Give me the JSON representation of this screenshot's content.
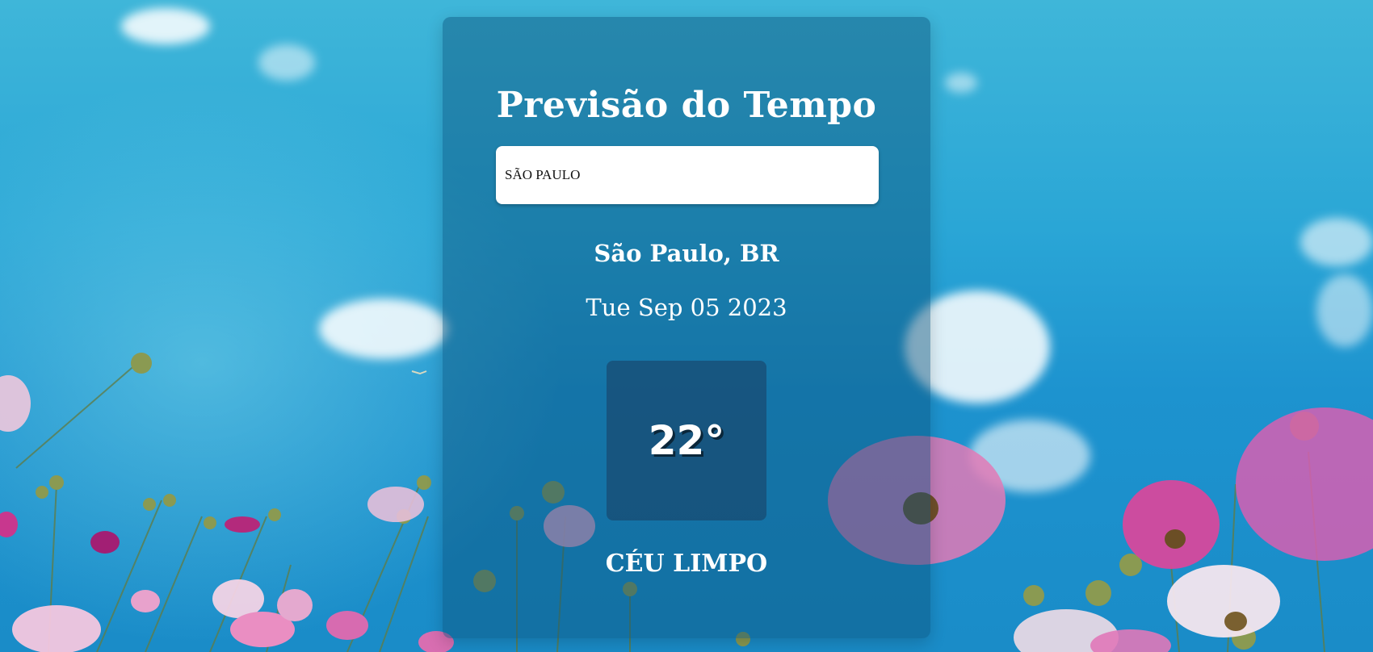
{
  "app": {
    "title": "Previsão do Tempo"
  },
  "search": {
    "value": "SÃO PAULO",
    "placeholder": ""
  },
  "weather": {
    "location": "São Paulo, BR",
    "date": "Tue Sep 05 2023",
    "temperature": "22°",
    "description": "CÉU LIMPO"
  },
  "colors": {
    "card_overlay": "#0a5078",
    "text": "#ffffff",
    "search_bg": "#ffffff"
  }
}
